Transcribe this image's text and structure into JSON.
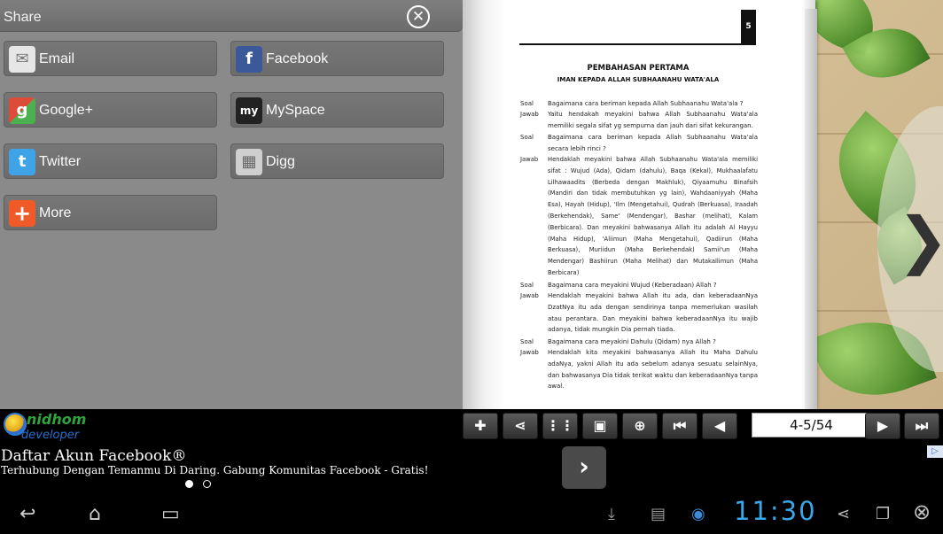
{
  "share_panel": {
    "title": "Share",
    "buttons": [
      {
        "label": "Email",
        "icon": "envelope-icon",
        "color": "#d8d8d8"
      },
      {
        "label": "Facebook",
        "icon": "facebook-icon",
        "color": "#3b5998"
      },
      {
        "label": "Google+",
        "icon": "google-plus-icon",
        "color": "#dd4b39"
      },
      {
        "label": "MySpace",
        "icon": "myspace-icon",
        "color": "#222222"
      },
      {
        "label": "Twitter",
        "icon": "twitter-icon",
        "color": "#3fa3e8"
      },
      {
        "label": "Digg",
        "icon": "digg-icon",
        "color": "#cfcfcf"
      },
      {
        "label": "More",
        "icon": "plus-icon",
        "color": "#f05a28"
      }
    ]
  },
  "book_page": {
    "page_number": "5",
    "heading": "PEMBAHASAN PERTAMA",
    "subheading": "IMAN KEPADA ALLAH SUBHAANAHU WATA'ALA",
    "entries": [
      {
        "label": "Soal",
        "text": "Bagaimana cara beriman kepada Allah Subhaanahu Wata'ala ?"
      },
      {
        "label": "Jawab",
        "text": "Yaitu hendakah meyakini bahwa Allah Subhaanahu Wata'ala memiliki segala sifat yg sempurna dan jauh dari sifat kekurangan."
      },
      {
        "label": "Soal",
        "text": "Bagaimana cara beriman kepada Allah Subhaanahu Wata'ala secara lebih rinci ?"
      },
      {
        "label": "Jawab",
        "text": "Hendaklah meyakini bahwa Allah Subhaanahu Wata'ala memiliki sifat : Wujud (Ada), Qidam (dahulu), Baqa (Kekal), Mukhaalafatu Lilhawaadits (Berbeda dengan Makhluk), Qiyaamuhu Binafsih (Mandiri dan tidak membutuhkan yg lain), Wahdaaniyyah (Maha Esa), Hayah (Hidup), 'Ilm (Mengetahui), Qudrah (Berkuasa), Iraadah (Berkehendak), Same' (Mendengar), Bashar (melihat), Kalam (Berbicara). Dan meyakini bahwasanya Allah itu adalah Al Hayyu (Maha Hidup), 'Aliimun (Maha Mengetahui), Qadiirun (Maha Berkuasa), Muriidun (Maha Berkehendak) Samii'un (Maha Mendengar) Bashiirun (Maha Melihat) dan Mutakallimun (Maha Berbicara)"
      },
      {
        "label": "Soal",
        "text": "Bagaimana cara meyakini Wujud (Keberadaan) Allah ?"
      },
      {
        "label": "Jawab",
        "text": "Hendaklah meyakini bahwa Allah itu ada, dan keberadaanNya DzatNya itu ada dengan sendirinya tanpa memerlukan wasilah atau perantara. Dan meyakini bahwa keberadaanNya itu wajib adanya, tidak mungkin Dia pernah tiada."
      },
      {
        "label": "Soal",
        "text": "Bagaimana cara meyakini Dahulu (Qidam) nya Allah ?"
      },
      {
        "label": "Jawab",
        "text": "Hendaklah kita meyakini bahwasanya Allah itu Maha Dahulu adaNya, yakni Allah itu ada sebelum adanya sesuatu selainNya, dan bahwasanya Dia tidak terikat waktu dan keberadaanNya tanpa awal."
      }
    ]
  },
  "toolbar": {
    "logo_line1": "nidhom",
    "logo_line2": "developer",
    "page_indicator": "4-5/54",
    "buttons": [
      "pin-icon",
      "share-icon",
      "grid-icon",
      "pages-icon",
      "zoom-icon",
      "first-page-icon",
      "prev-page-icon",
      "next-page-icon",
      "last-page-icon"
    ]
  },
  "ad": {
    "title": "Daftar Akun Facebook®",
    "subtitle": "Terhubung Dengan Temanmu Di Daring. Gabung Komunitas Facebook - Gratis!"
  },
  "system_bar": {
    "clock": "11:30"
  }
}
